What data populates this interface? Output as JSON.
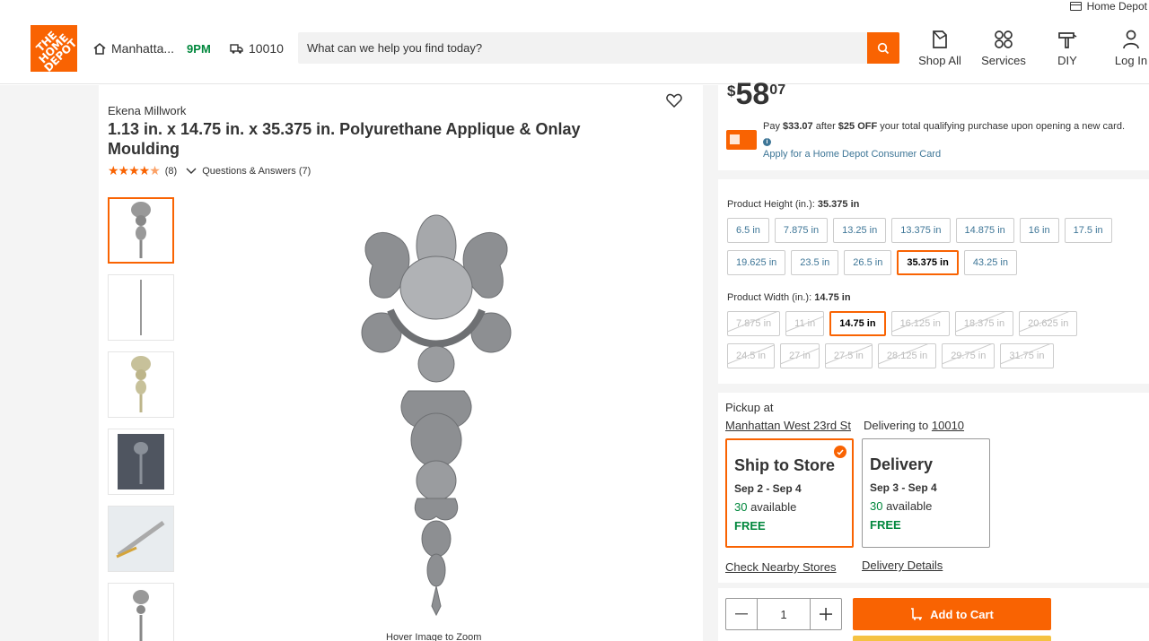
{
  "header": {
    "top_link": "Home Depot",
    "logo_text": "THE HOME DEPOT",
    "store_name": "Manhatta...",
    "store_close": "9PM",
    "zip": "10010",
    "search_placeholder": "What can we help you find today?",
    "nav": [
      {
        "label": "Shop All",
        "icon": "shop-all-icon"
      },
      {
        "label": "Services",
        "icon": "services-icon"
      },
      {
        "label": "DIY",
        "icon": "diy-hammer-icon"
      },
      {
        "label": "Log In",
        "icon": "user-icon"
      }
    ],
    "accent_color": "#f96302"
  },
  "product": {
    "brand": "Ekena Millwork",
    "title": "1.13 in. x 14.75 in. x 35.375 in. Polyurethane Applique & Onlay Moulding",
    "rating_count": "(8)",
    "rating_value": 4.5,
    "qa_label": "Questions & Answers (7)",
    "hover_text": "Hover Image to Zoom"
  },
  "price": {
    "currency": "$",
    "dollars": "58",
    "cents": "07"
  },
  "promo": {
    "line_a": "Pay ",
    "amount": "$33.07",
    "line_b": " after ",
    "discount": "$25 OFF",
    "line_c": " your total qualifying purchase upon opening a new card.",
    "link": "Apply for a Home Depot Consumer Card"
  },
  "height_option": {
    "label": "Product Height (in.):",
    "value": "35.375 in",
    "options": [
      {
        "label": "6.5 in",
        "state": "normal"
      },
      {
        "label": "7.875 in",
        "state": "normal"
      },
      {
        "label": "13.25 in",
        "state": "normal"
      },
      {
        "label": "13.375 in",
        "state": "normal"
      },
      {
        "label": "14.875 in",
        "state": "normal"
      },
      {
        "label": "16 in",
        "state": "normal"
      },
      {
        "label": "17.5 in",
        "state": "normal"
      },
      {
        "label": "19.625 in",
        "state": "normal"
      },
      {
        "label": "23.5 in",
        "state": "normal"
      },
      {
        "label": "26.5 in",
        "state": "normal"
      },
      {
        "label": "35.375 in",
        "state": "selected"
      },
      {
        "label": "43.25 in",
        "state": "normal"
      }
    ]
  },
  "width_option": {
    "label": "Product Width (in.):",
    "value": "14.75 in",
    "options": [
      {
        "label": "7.875 in",
        "state": "disabled"
      },
      {
        "label": "11 in",
        "state": "disabled"
      },
      {
        "label": "14.75 in",
        "state": "selected"
      },
      {
        "label": "16.125 in",
        "state": "disabled"
      },
      {
        "label": "18.375 in",
        "state": "disabled"
      },
      {
        "label": "20.625 in",
        "state": "disabled"
      },
      {
        "label": "24.5 in",
        "state": "disabled"
      },
      {
        "label": "27 in",
        "state": "disabled"
      },
      {
        "label": "27.5 in",
        "state": "disabled"
      },
      {
        "label": "28.125 in",
        "state": "disabled"
      },
      {
        "label": "29.75 in",
        "state": "disabled"
      },
      {
        "label": "31.75 in",
        "state": "disabled"
      }
    ]
  },
  "fulfillment": {
    "pickup_label": "Pickup at",
    "store_link": "Manhattan West 23rd St",
    "delivering_label": "Delivering to ",
    "delivering_zip": "10010",
    "ship": {
      "title": "Ship to Store",
      "dates": "Sep 2 - Sep 4",
      "avail_num": "30",
      "avail_txt": " available",
      "cost": "FREE"
    },
    "delivery": {
      "title": "Delivery",
      "dates": "Sep 3 - Sep 4",
      "avail_num": "30",
      "avail_txt": " available",
      "cost": "FREE"
    },
    "check_stores": "Check Nearby Stores",
    "delivery_details": "Delivery Details"
  },
  "cart": {
    "quantity": "1",
    "minus": "—",
    "plus": "+",
    "add_label": "Add to Cart"
  }
}
